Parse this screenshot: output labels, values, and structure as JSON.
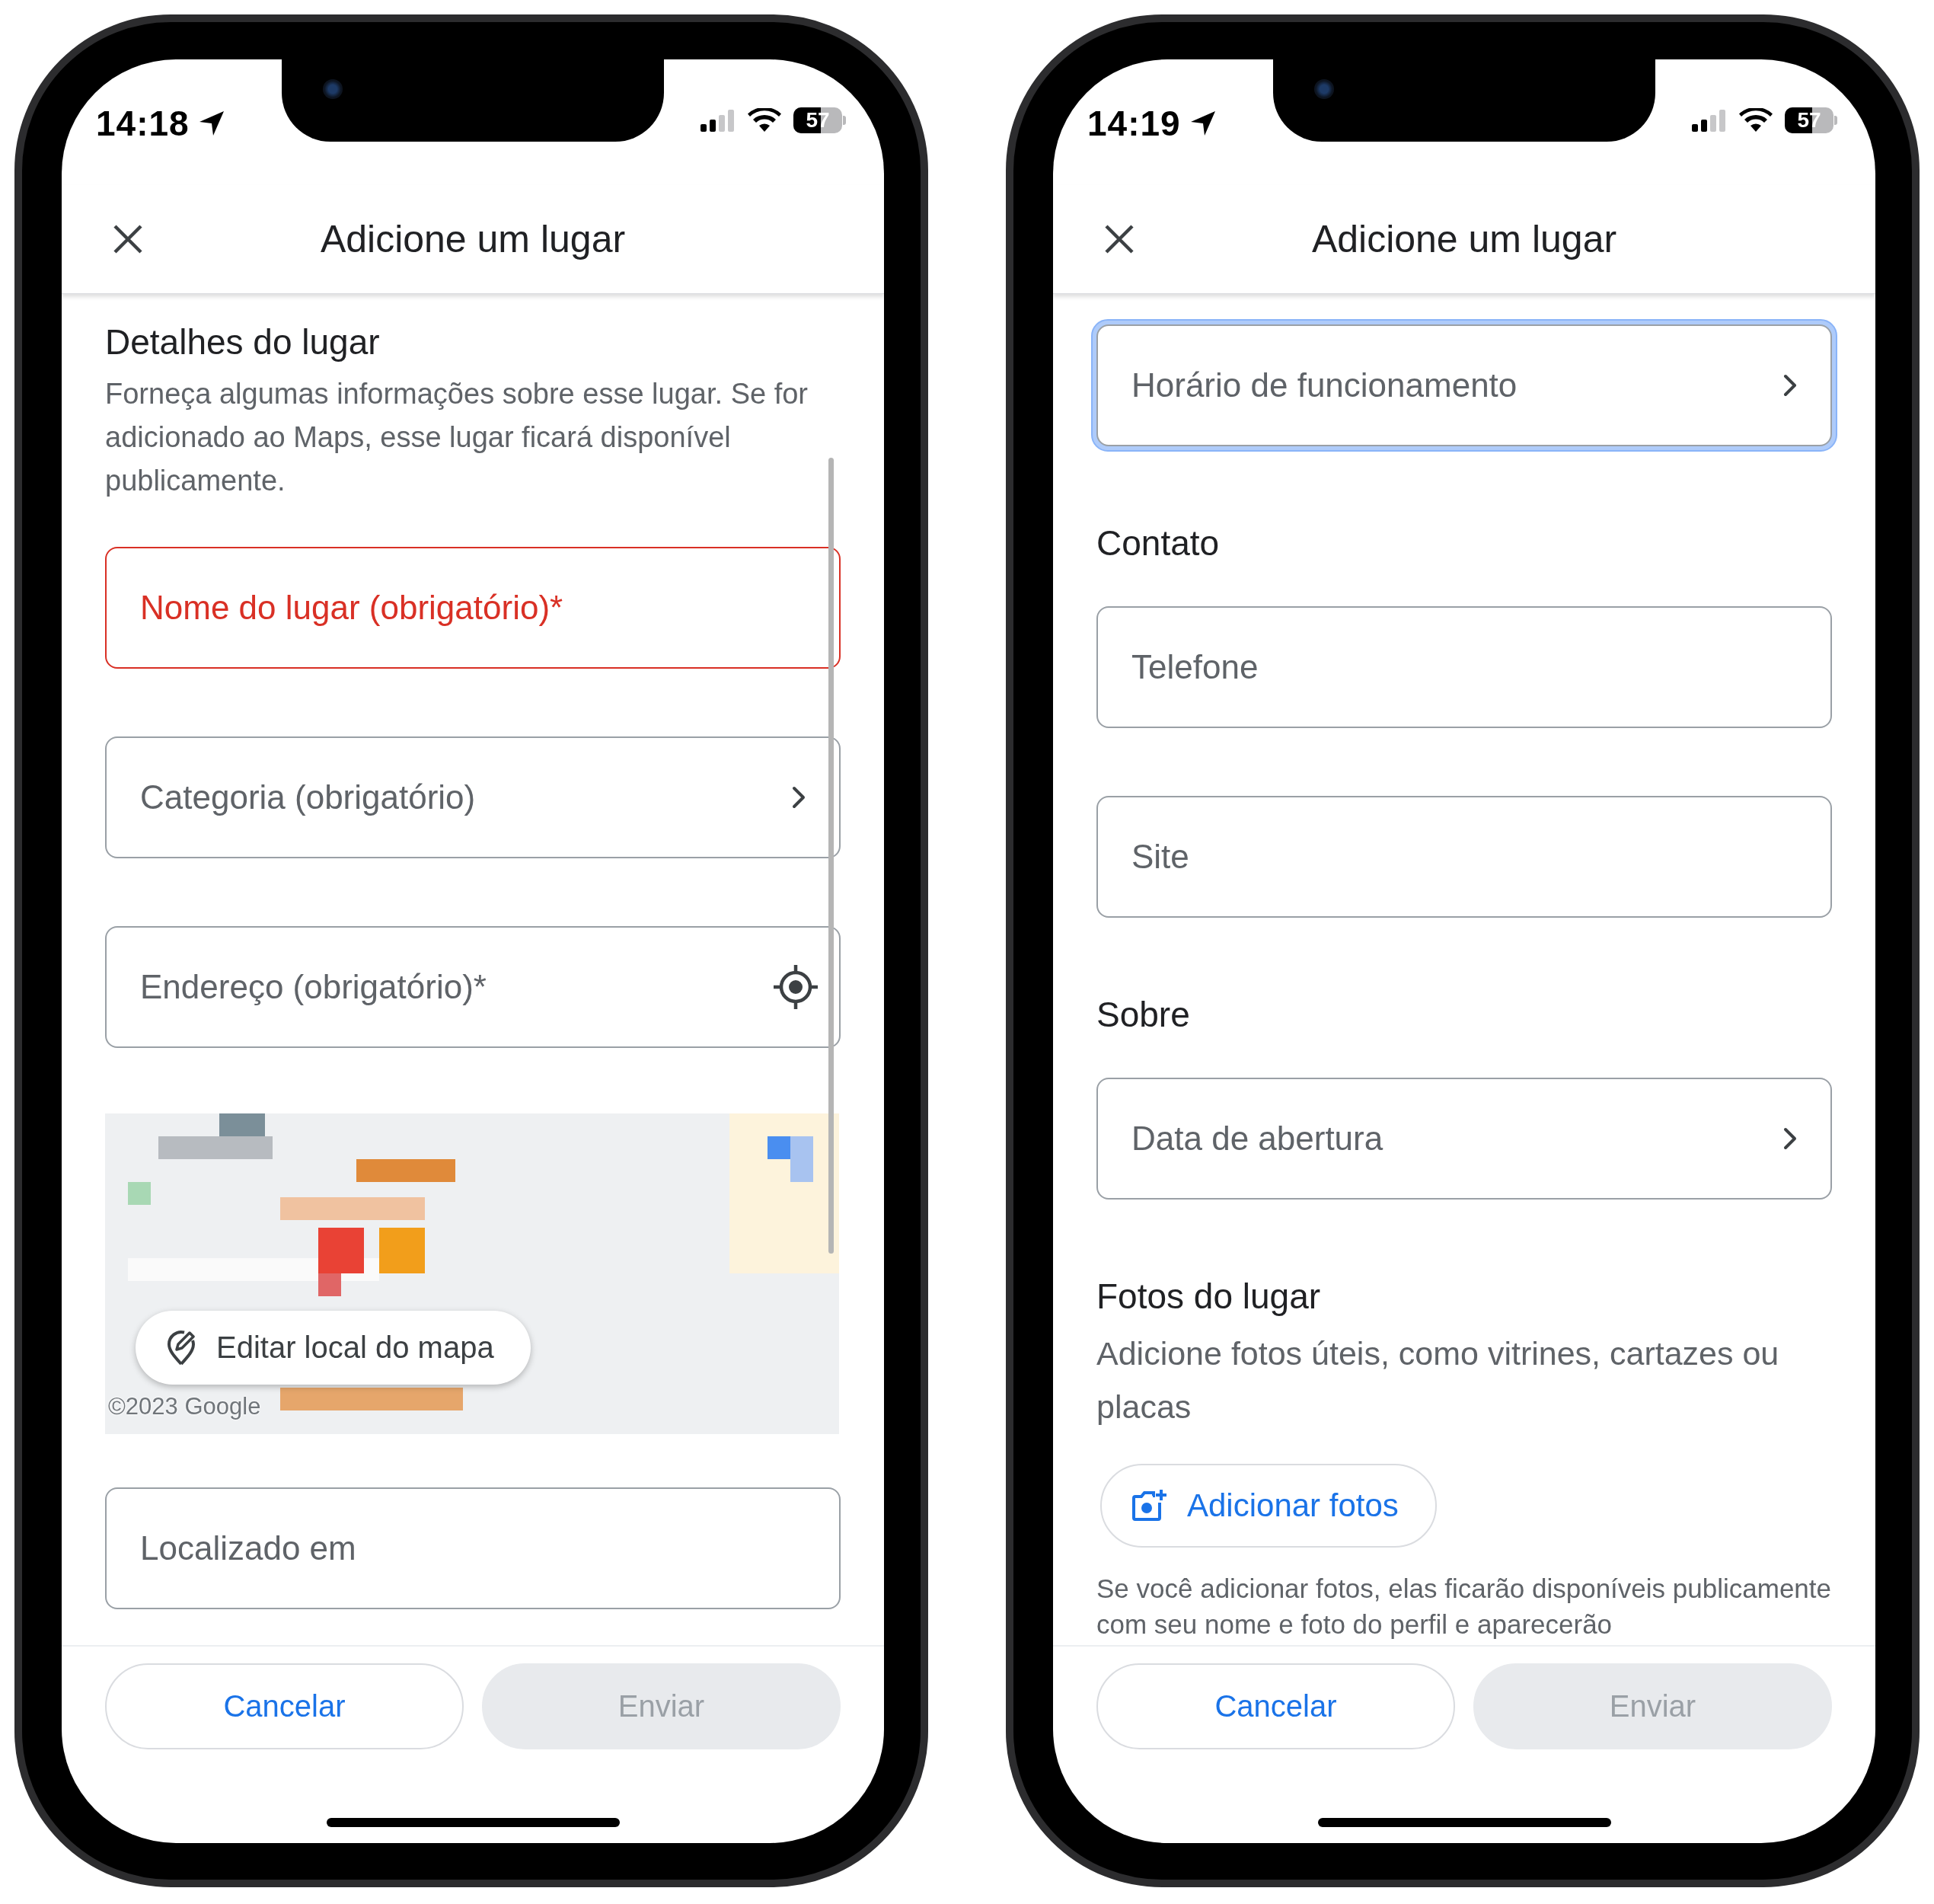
{
  "phones": [
    {
      "status_bar": {
        "time": "14:18",
        "battery": "57"
      },
      "header": {
        "title": "Adicione um lugar"
      },
      "scroll_indicator": true,
      "content": [
        {
          "kind": "heading",
          "text": "Detalhes do lugar"
        },
        {
          "kind": "description",
          "text": "Forneça algumas informações sobre esse lugar. Se for adicionado ao Maps, esse lugar ficará disponível publicamente."
        },
        {
          "kind": "field",
          "placeholder": "Nome do lugar (obrigatório)*",
          "error": true,
          "focused": false
        },
        {
          "kind": "select_field",
          "placeholder": "Categoria (obrigatório)",
          "error": false,
          "focused": false
        },
        {
          "kind": "location_field",
          "placeholder": "Endereço (obrigatório)*",
          "error": false,
          "focused": false
        },
        {
          "kind": "map",
          "button": "Editar local do mapa",
          "attribution": "©2023 Google"
        },
        {
          "kind": "field",
          "placeholder": "Localizado em",
          "error": false,
          "focused": false
        }
      ],
      "footer": {
        "buttons": [
          {
            "label": "Cancelar",
            "disabled": false
          },
          {
            "label": "Enviar",
            "disabled": true
          }
        ]
      }
    },
    {
      "status_bar": {
        "time": "14:19",
        "battery": "57"
      },
      "header": {
        "title": "Adicione um lugar"
      },
      "scroll_indicator": false,
      "content": [
        {
          "kind": "select_field",
          "placeholder": "Horário de funcionamento",
          "error": false,
          "focused": true
        },
        {
          "kind": "heading",
          "text": "Contato"
        },
        {
          "kind": "field",
          "placeholder": "Telefone",
          "error": false,
          "focused": false
        },
        {
          "kind": "field",
          "placeholder": "Site",
          "error": false,
          "focused": false
        },
        {
          "kind": "heading",
          "text": "Sobre"
        },
        {
          "kind": "select_field",
          "placeholder": "Data de abertura",
          "error": false,
          "focused": false
        },
        {
          "kind": "heading",
          "text": "Fotos do lugar"
        },
        {
          "kind": "lead",
          "text": "Adicione fotos úteis, como vitrines, cartazes ou placas"
        },
        {
          "kind": "button",
          "label": "Adicionar fotos"
        },
        {
          "kind": "note",
          "text": "Se você adicionar fotos, elas ficarão disponíveis publicamente com seu nome e foto do perfil e aparecerão"
        }
      ],
      "footer": {
        "buttons": [
          {
            "label": "Cancelar",
            "disabled": false
          },
          {
            "label": "Enviar",
            "disabled": true
          }
        ]
      }
    }
  ]
}
